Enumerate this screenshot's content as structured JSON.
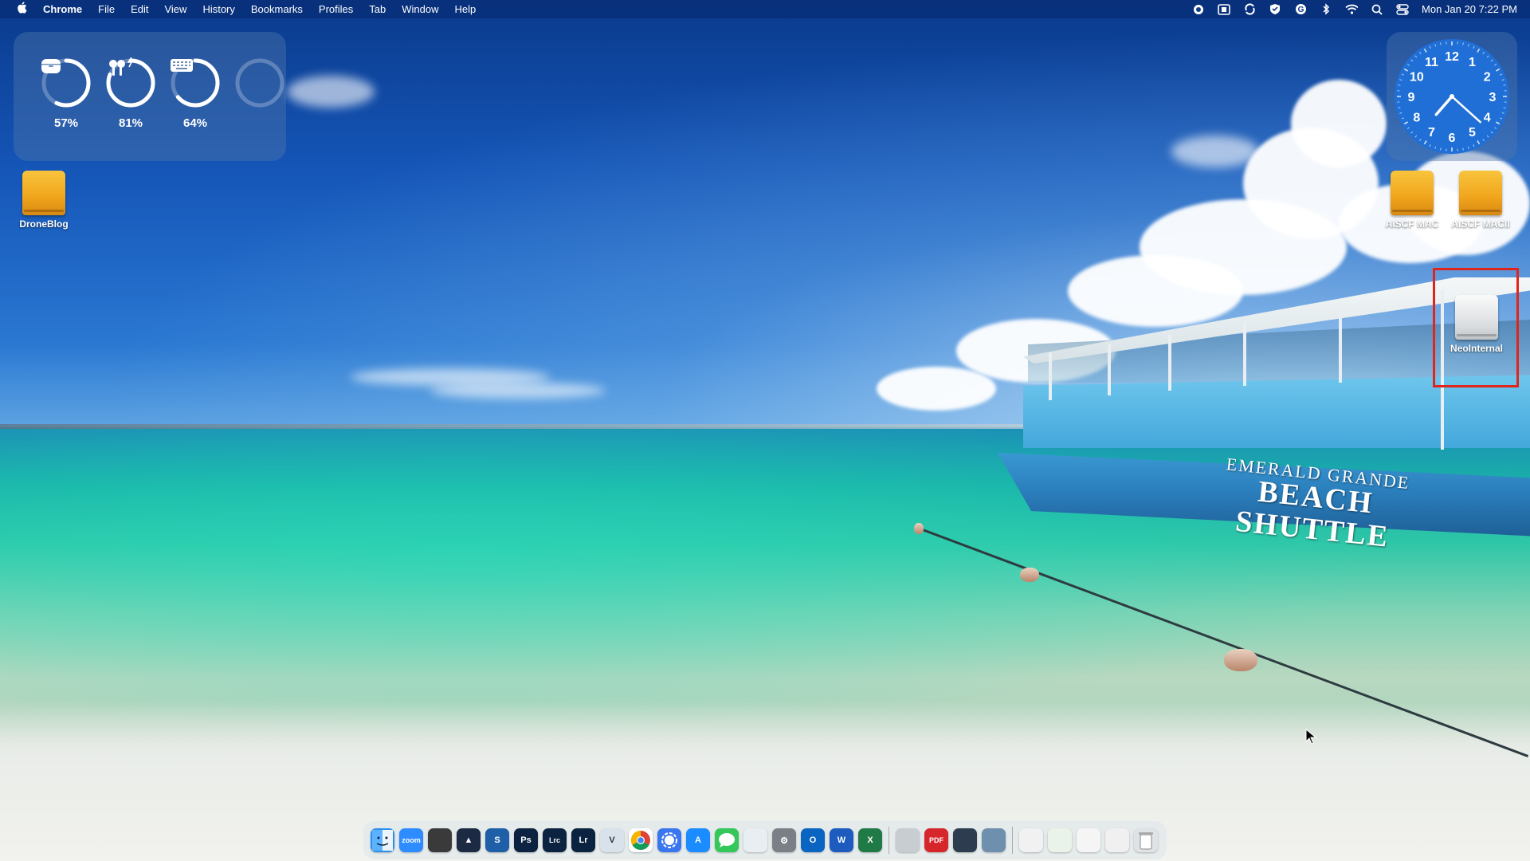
{
  "menubar": {
    "app_name": "Chrome",
    "menus": [
      "File",
      "Edit",
      "View",
      "History",
      "Bookmarks",
      "Profiles",
      "Tab",
      "Window",
      "Help"
    ],
    "datetime": "Mon Jan 20  7:22 PM",
    "status_icons": [
      "record-icon",
      "screenshot-icon",
      "sync-icon",
      "vpn-icon",
      "grammarly-icon",
      "bluetooth-icon",
      "wifi-icon",
      "search-icon",
      "control-center-icon"
    ]
  },
  "battery_widget": {
    "devices": [
      {
        "name": "case",
        "icon": "airpods-case-icon",
        "percent_label": "57%",
        "level": 0.57
      },
      {
        "name": "airpods",
        "icon": "airpods-icon",
        "percent_label": "81%",
        "level": 0.81,
        "charging": true
      },
      {
        "name": "keyboard",
        "icon": "keyboard-icon",
        "percent_label": "64%",
        "level": 0.64
      },
      {
        "name": "empty",
        "icon": "",
        "percent_label": "",
        "level": 0
      }
    ]
  },
  "clock_widget": {
    "numbers": [
      "12",
      "1",
      "2",
      "3",
      "4",
      "5",
      "6",
      "7",
      "8",
      "9",
      "10",
      "11"
    ],
    "hour": 7,
    "minute": 22
  },
  "desktop_icons": {
    "droneblog": "DroneBlog",
    "aiscf_mac": "AISCF MAC",
    "aiscf_macii": "AISCF MACII",
    "neointernal": "NeoInternal"
  },
  "boat_text": {
    "line1": "EMERALD GRANDE",
    "line2": "BEACH SHUTTLE"
  },
  "dock": {
    "apps": [
      {
        "name": "finder",
        "label": "",
        "color": "#2b8ff0"
      },
      {
        "name": "zoom",
        "label": "zoom",
        "color": "#2d8cff"
      },
      {
        "name": "davinci-resolve",
        "label": "",
        "color": "#3a3a3a"
      },
      {
        "name": "affinity",
        "label": "▲",
        "color": "#1d2a44"
      },
      {
        "name": "scrivener",
        "label": "S",
        "color": "#1f5fa8"
      },
      {
        "name": "photoshop",
        "label": "Ps",
        "color": "#0b2340"
      },
      {
        "name": "lightroom-classic",
        "label": "Lrc",
        "color": "#0b2340"
      },
      {
        "name": "lightroom",
        "label": "Lr",
        "color": "#0b2340"
      },
      {
        "name": "vectorworks",
        "label": "V",
        "color": "#d9e2ea"
      },
      {
        "name": "chrome",
        "label": "",
        "color": "#ffffff"
      },
      {
        "name": "signal",
        "label": "",
        "color": "#3a76f0"
      },
      {
        "name": "app-store",
        "label": "A",
        "color": "#1a8cff"
      },
      {
        "name": "messages",
        "label": "",
        "color": "#34c759"
      },
      {
        "name": "launchpad",
        "label": "",
        "color": "#e9eef3"
      },
      {
        "name": "system-settings",
        "label": "⚙",
        "color": "#7b8087"
      },
      {
        "name": "outlook",
        "label": "O",
        "color": "#0a64c2"
      },
      {
        "name": "word",
        "label": "W",
        "color": "#1d5bbf"
      },
      {
        "name": "excel",
        "label": "X",
        "color": "#1f7a45"
      },
      {
        "name": "disk-utility",
        "label": "",
        "color": "#c8cdd2"
      },
      {
        "name": "pdf-expert",
        "label": "PDF",
        "color": "#d6262c"
      },
      {
        "name": "quicktime",
        "label": "",
        "color": "#2d3c4e"
      },
      {
        "name": "screen-sharing",
        "label": "",
        "color": "#6e8fae"
      },
      {
        "name": "textedit",
        "label": "",
        "color": "#f1f1f1"
      },
      {
        "name": "numbers-doc",
        "label": "",
        "color": "#e9f3ea"
      },
      {
        "name": "document-1",
        "label": "",
        "color": "#f5f5f5"
      },
      {
        "name": "document-2",
        "label": "",
        "color": "#f0f0f0"
      },
      {
        "name": "trash",
        "label": "",
        "color": "#dfe3e6"
      }
    ]
  }
}
